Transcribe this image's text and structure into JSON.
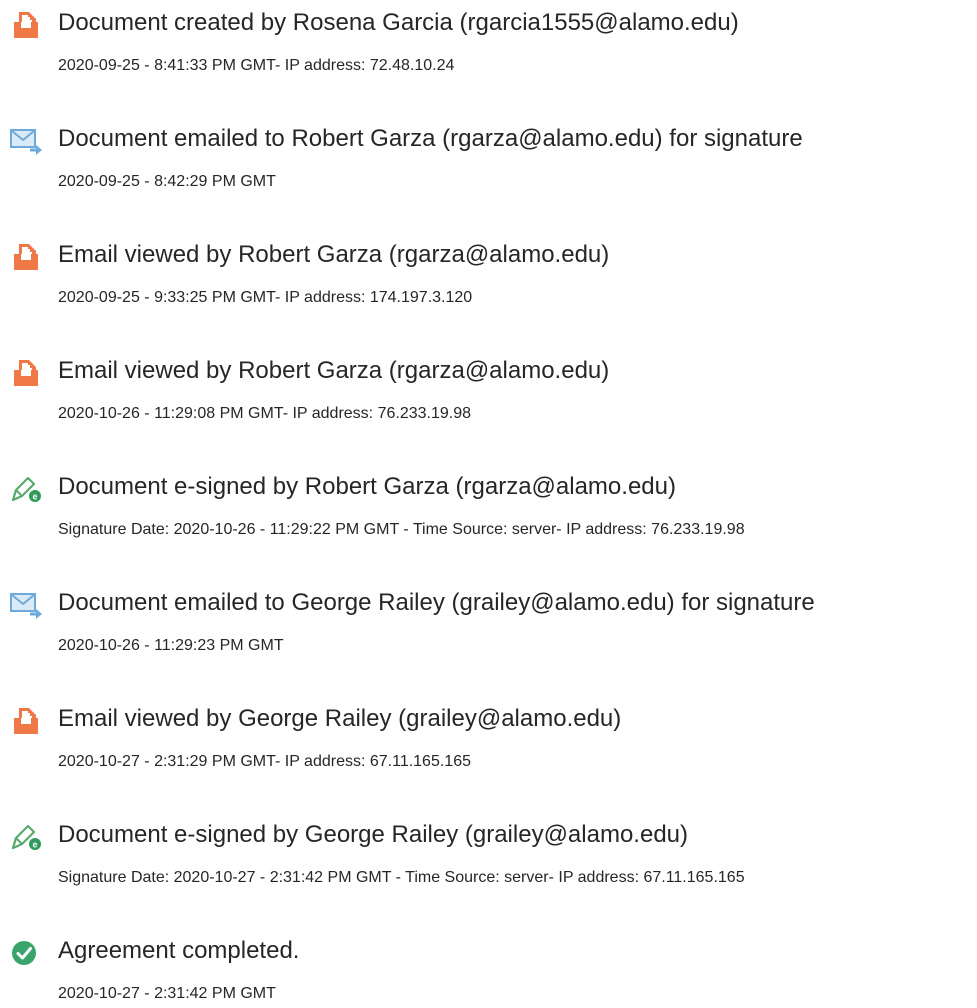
{
  "colors": {
    "doc_icon": "#f07847",
    "email_icon": "#6ea9dc",
    "sign_icon": "#4aa86a",
    "complete_icon": "#3aa56b"
  },
  "events": [
    {
      "icon": "document-icon",
      "title": "Document created by Rosena Garcia (rgarcia1555@alamo.edu)",
      "detail": "2020-09-25 - 8:41:33 PM GMT- IP address: 72.48.10.24"
    },
    {
      "icon": "email-icon",
      "title": "Document emailed to Robert Garza (rgarza@alamo.edu) for signature",
      "detail": "2020-09-25 - 8:42:29 PM GMT"
    },
    {
      "icon": "document-icon",
      "title": "Email viewed by Robert Garza (rgarza@alamo.edu)",
      "detail": "2020-09-25 - 9:33:25 PM GMT- IP address: 174.197.3.120"
    },
    {
      "icon": "document-icon",
      "title": "Email viewed by Robert Garza (rgarza@alamo.edu)",
      "detail": "2020-10-26 - 11:29:08 PM GMT- IP address: 76.233.19.98"
    },
    {
      "icon": "esign-icon",
      "title": "Document e-signed by Robert Garza (rgarza@alamo.edu)",
      "detail": "Signature Date: 2020-10-26 - 11:29:22 PM GMT - Time Source: server- IP address: 76.233.19.98"
    },
    {
      "icon": "email-icon",
      "title": "Document emailed to George Railey (grailey@alamo.edu) for signature",
      "detail": "2020-10-26 - 11:29:23 PM GMT"
    },
    {
      "icon": "document-icon",
      "title": "Email viewed by George Railey (grailey@alamo.edu)",
      "detail": "2020-10-27 - 2:31:29 PM GMT- IP address: 67.11.165.165"
    },
    {
      "icon": "esign-icon",
      "title": "Document e-signed by George Railey (grailey@alamo.edu)",
      "detail": "Signature Date: 2020-10-27 - 2:31:42 PM GMT - Time Source: server- IP address: 67.11.165.165"
    },
    {
      "icon": "checkmark-circle-icon",
      "title": "Agreement completed.",
      "detail": "2020-10-27 - 2:31:42 PM GMT"
    }
  ]
}
